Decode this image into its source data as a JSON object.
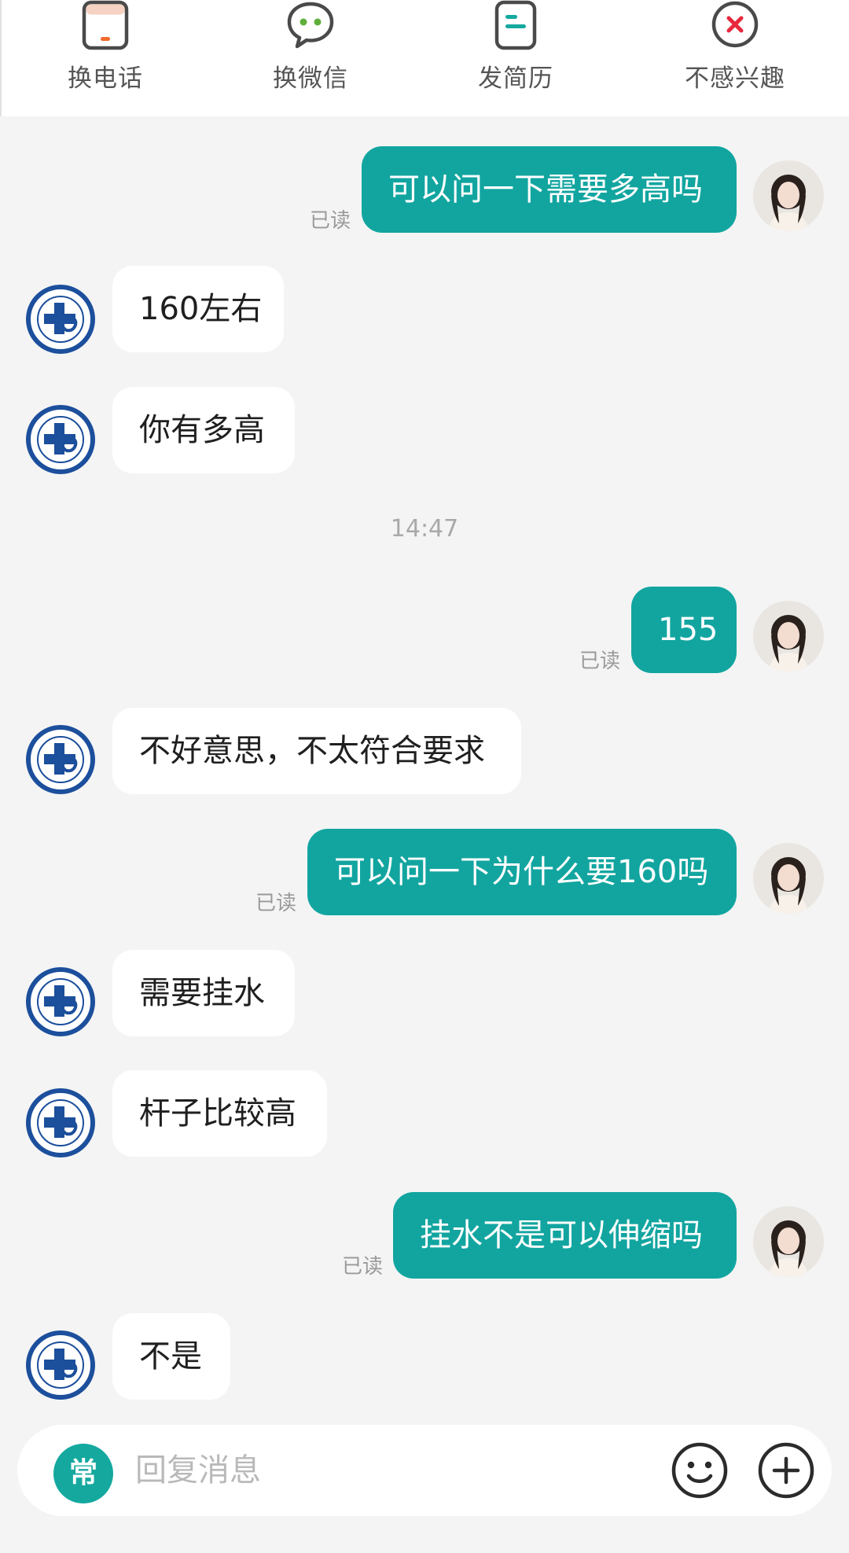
{
  "actions": [
    {
      "label": "换电话",
      "icon": "phone-icon"
    },
    {
      "label": "换微信",
      "icon": "wechat-icon"
    },
    {
      "label": "发简历",
      "icon": "resume-icon"
    },
    {
      "label": "不感兴趣",
      "icon": "not-interested-icon"
    }
  ],
  "read_label": "已读",
  "timestamp": "14:47",
  "messages": [
    {
      "side": "out",
      "text": "可以问一下需要多高吗",
      "status": "已读"
    },
    {
      "side": "in",
      "text": "160左右"
    },
    {
      "side": "in",
      "text": "你有多高"
    },
    {
      "side": "out",
      "text": "155",
      "status": "已读"
    },
    {
      "side": "in",
      "text": "不好意思，不太符合要求"
    },
    {
      "side": "out",
      "text": "可以问一下为什么要160吗",
      "status": "已读"
    },
    {
      "side": "in",
      "text": "需要挂水"
    },
    {
      "side": "in",
      "text": "杆子比较高"
    },
    {
      "side": "out",
      "text": "挂水不是可以伸缩吗",
      "status": "已读"
    },
    {
      "side": "in",
      "text": "不是"
    }
  ],
  "input": {
    "common_phrases_label": "常",
    "placeholder": "回复消息",
    "value": ""
  },
  "colors": {
    "accent": "#12a5a0",
    "outgoing_bubble": "#12a5a0",
    "incoming_bubble": "#ffffff",
    "background": "#f4f4f4",
    "phone_icon_accent": "#f26a2e",
    "wechat_icon_accent": "#5fb03a",
    "resume_icon_accent": "#14a89f",
    "not_interested_icon_accent": "#e8283c",
    "company_logo": "#1c4f9c"
  }
}
